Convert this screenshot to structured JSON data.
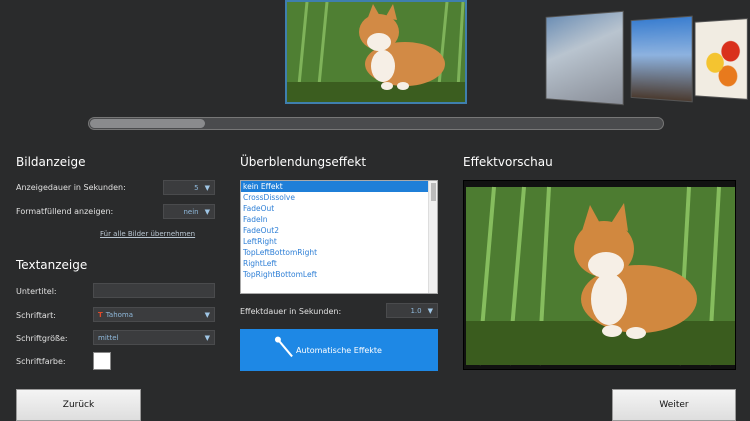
{
  "carousel": {
    "current_image_icon": "cat-photo",
    "side_images": [
      "building-photo",
      "city-photo",
      "fruits-photo"
    ],
    "progress_fraction": 0.2
  },
  "image_display": {
    "heading": "Bildanzeige",
    "duration_label": "Anzeigedauer in Sekunden:",
    "duration_value": "5",
    "fill_label": "Formatfüllend anzeigen:",
    "fill_value": "nein",
    "apply_all_link": "Für alle Bilder übernehmen"
  },
  "text_display": {
    "heading": "Textanzeige",
    "subtitle_label": "Untertitel:",
    "subtitle_value": "",
    "font_label": "Schriftart:",
    "font_value": "Tahoma",
    "size_label": "Schriftgröße:",
    "size_value": "mittel",
    "color_label": "Schriftfarbe:",
    "color_value": "#ffffff"
  },
  "transition": {
    "heading": "Überblendungseffekt",
    "effects": [
      "kein Effekt",
      "CrossDissolve",
      "FadeOut",
      "FadeIn",
      "FadeOut2",
      "LeftRight",
      "TopLeftBottomRight",
      "RightLeft",
      "TopRightBottomLeft"
    ],
    "selected_index": 0,
    "duration_label": "Effektdauer in Sekunden:",
    "duration_value": "1.0",
    "auto_button": "Automatische Effekte"
  },
  "preview": {
    "heading": "Effektvorschau",
    "image_icon": "cat-photo"
  },
  "nav": {
    "back_label": "Zurück",
    "next_label": "Weiter"
  },
  "colors": {
    "background": "#2a2b2c",
    "accent": "#1e88e5",
    "selection": "#1f7fd8"
  }
}
